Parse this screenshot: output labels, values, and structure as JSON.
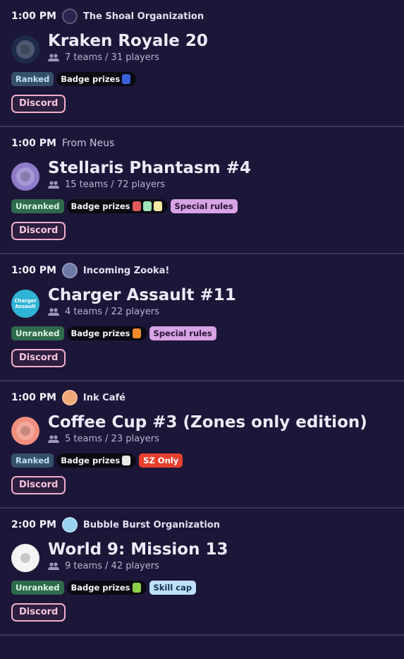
{
  "tournaments": [
    {
      "time": "1:00 PM",
      "org_name": "The Shoal Organization",
      "org_plain": false,
      "org_logo_color": "#2a2550",
      "logo_bg": "#1e2a4a",
      "title": "Kraken Royale 20",
      "teams": "7 teams / 31 players",
      "ranked_label": "Ranked",
      "ranked": true,
      "prizes_label": "Badge prizes",
      "prize_icons": [
        "#3a5fd9"
      ],
      "extra_badges": [],
      "discord_label": "Discord"
    },
    {
      "time": "1:00 PM",
      "org_name": "From Neus",
      "org_plain": true,
      "org_logo_color": "",
      "logo_bg": "#8f7cc9",
      "title": "Stellaris Phantasm #4",
      "teams": "15 teams / 72 players",
      "ranked_label": "Unranked",
      "ranked": false,
      "prizes_label": "Badge prizes",
      "prize_icons": [
        "#e05a5a",
        "#9fe0b8",
        "#f3e6a6"
      ],
      "extra_badges": [
        {
          "label": "Special rules",
          "kind": "special"
        }
      ],
      "discord_label": "Discord"
    },
    {
      "time": "1:00 PM",
      "org_name": "Incoming Zooka!",
      "org_plain": false,
      "org_logo_color": "#6d7aa8",
      "logo_bg": "#2fb3d6",
      "logo_text": "Charger Assault",
      "title": "Charger Assault #11",
      "teams": "4 teams / 22 players",
      "ranked_label": "Unranked",
      "ranked": false,
      "prizes_label": "Badge prizes",
      "prize_icons": [
        "#f08a2c"
      ],
      "extra_badges": [
        {
          "label": "Special rules",
          "kind": "special"
        }
      ],
      "discord_label": "Discord"
    },
    {
      "time": "1:00 PM",
      "org_name": "Ink Café",
      "org_plain": false,
      "org_logo_color": "#f0a878",
      "logo_bg": "#f08f7e",
      "title": "Coffee Cup #3 (Zones only edition)",
      "teams": "5 teams / 23 players",
      "ranked_label": "Ranked",
      "ranked": true,
      "prizes_label": "Badge prizes",
      "prize_icons": [
        "#e9e9e9"
      ],
      "extra_badges": [
        {
          "label": "SZ Only",
          "kind": "sz"
        }
      ],
      "discord_label": "Discord"
    },
    {
      "time": "2:00 PM",
      "org_name": "Bubble Burst Organization",
      "org_plain": false,
      "org_logo_color": "#9ad0f0",
      "logo_bg": "#f3f3f3",
      "title": "World 9: Mission 13",
      "teams": "9 teams / 42 players",
      "ranked_label": "Unranked",
      "ranked": false,
      "prizes_label": "Badge prizes",
      "prize_icons": [
        "#8ad04a"
      ],
      "extra_badges": [
        {
          "label": "Skill cap",
          "kind": "skillcap"
        }
      ],
      "discord_label": "Discord"
    }
  ]
}
